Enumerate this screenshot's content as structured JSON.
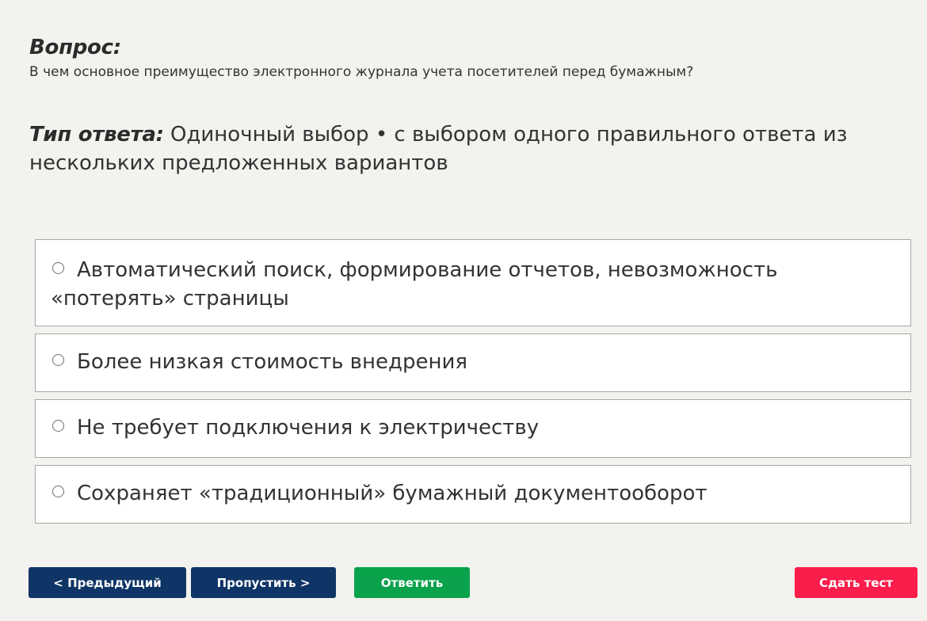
{
  "question": {
    "label": "Вопрос:",
    "text": "В чем основное преимущество электронного журнала учета посетителей перед бумажным?"
  },
  "answer_type": {
    "label": "Тип ответа:",
    "text": "Одиночный выбор • с выбором одного правильного ответа из нескольких предложенных вариантов"
  },
  "options": [
    {
      "label": "Автоматический поиск, формирование отчетов, невозможность «потерять» страницы",
      "selected": false
    },
    {
      "label": "Более низкая стоимость внедрения",
      "selected": false
    },
    {
      "label": "Не требует подключения к электричеству",
      "selected": false
    },
    {
      "label": "Сохраняет «традиционный» бумажный документооборот",
      "selected": false
    }
  ],
  "buttons": {
    "prev": "< Предыдущий",
    "skip": "Пропустить >",
    "answer": "Ответить",
    "submit": "Сдать тест"
  },
  "colors": {
    "background": "#f3f2ef",
    "nav_button": "#0f3566",
    "answer_button": "#0aa24a",
    "submit_button": "#fb1d4b"
  },
  "icons": {
    "option_marker": "radio-unchecked-icon"
  }
}
